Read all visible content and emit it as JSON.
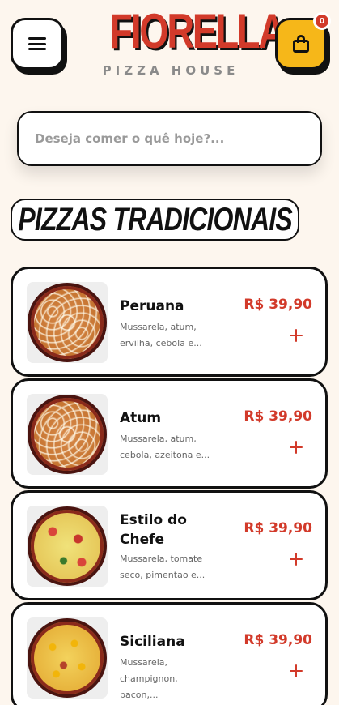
{
  "header": {
    "brand_name": "FIORELLA",
    "brand_sub": "PIZZA HOUSE",
    "cart_count": "0",
    "menu_icon": "menu-icon",
    "cart_icon": "shopping-bag-icon"
  },
  "search": {
    "placeholder": "Deseja comer o quê hoje?..."
  },
  "section": {
    "title": "PIZZAS TRADICIONAIS"
  },
  "products": [
    {
      "name": "Peruana",
      "description": "Mussarela, atum, ervilha, cebola e...",
      "price": "R$ 39,90"
    },
    {
      "name": "Atum",
      "description": "Mussarela, atum, cebola, azeitona e...",
      "price": "R$ 39,90"
    },
    {
      "name": "Estilo do Chefe",
      "description": "Mussarela, tomate seco, pimentao e...",
      "price": "R$ 39,90"
    },
    {
      "name": "Siciliana",
      "description": "Mussarela, champignon, bacon,...",
      "price": "R$ 39,90"
    }
  ],
  "colors": {
    "background": "#fdf6ee",
    "accent_red": "#d23a2a",
    "accent_yellow": "#f6b719"
  }
}
